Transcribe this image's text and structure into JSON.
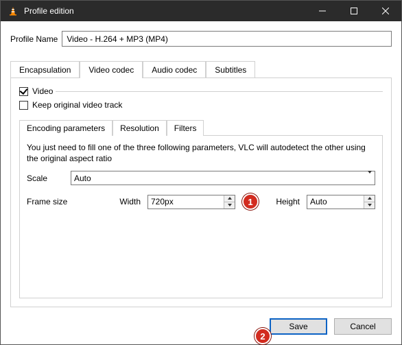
{
  "window": {
    "title": "Profile edition"
  },
  "profile": {
    "label": "Profile Name",
    "value": "Video - H.264 + MP3 (MP4)"
  },
  "tabs": {
    "encapsulation": "Encapsulation",
    "video_codec": "Video codec",
    "audio_codec": "Audio codec",
    "subtitles": "Subtitles"
  },
  "video_panel": {
    "video_checkbox": "Video",
    "keep_original": "Keep original video track",
    "inner_tabs": {
      "encoding": "Encoding parameters",
      "resolution": "Resolution",
      "filters": "Filters"
    },
    "resolution": {
      "hint": "You just need to fill one of the three following parameters, VLC will autodetect the other using the original aspect ratio",
      "scale_label": "Scale",
      "scale_value": "Auto",
      "frame_size_label": "Frame size",
      "width_label": "Width",
      "width_value": "720px",
      "height_label": "Height",
      "height_value": "Auto"
    }
  },
  "annotations": {
    "badge1": "1",
    "badge2": "2"
  },
  "footer": {
    "save": "Save",
    "cancel": "Cancel"
  }
}
